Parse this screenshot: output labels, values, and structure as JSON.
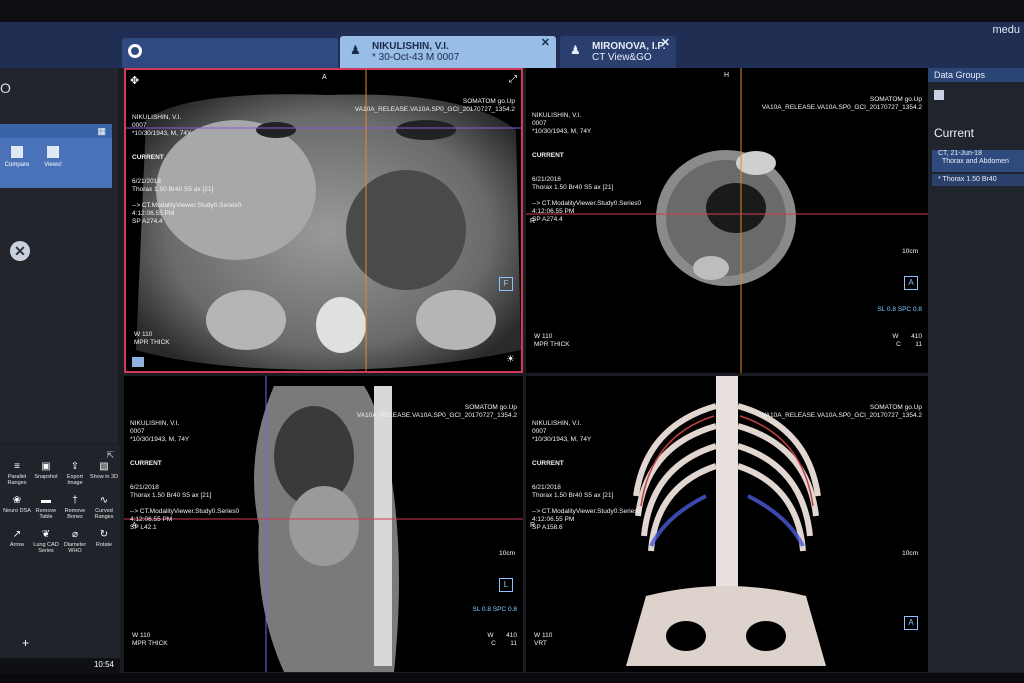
{
  "topbar": {
    "user": "medu"
  },
  "tabs": [
    {
      "name": "NIKULISHIN, V.I.",
      "sub": "* 30-Oct-43 M 0007",
      "active": true
    },
    {
      "name": "MIRONOVA, I.P.",
      "sub": "CT View&GO",
      "active": false
    }
  ],
  "left_panel": {
    "top_label": "O",
    "tools_top": [
      "Compare",
      "Views!"
    ],
    "tools": [
      {
        "label": "Parallel Ranges",
        "icon": "stack-icon"
      },
      {
        "label": "Snapshot",
        "icon": "camera-icon"
      },
      {
        "label": "Export Image",
        "icon": "export-icon"
      },
      {
        "label": "Show in 3D",
        "icon": "cube-icon"
      },
      {
        "label": "Neuro DSA",
        "icon": "brain-icon"
      },
      {
        "label": "Remove Table",
        "icon": "table-icon"
      },
      {
        "label": "Remove Bones",
        "icon": "bone-icon"
      },
      {
        "label": "Curved Ranges",
        "icon": "curve-icon"
      },
      {
        "label": "Arrow",
        "icon": "arrow-icon"
      },
      {
        "label": "Lung CAD Series",
        "icon": "lung-icon"
      },
      {
        "label": "Diameter WHO",
        "icon": "diameter-icon"
      },
      {
        "label": "Rotate",
        "icon": "rotate-icon"
      }
    ],
    "time": "10:54",
    "add": "+"
  },
  "right_panel": {
    "header": "Data Groups",
    "current": "Current",
    "group_title": "CT, 21-Jun-18",
    "group_sub": "Thorax and Abdomen",
    "series": "* Thorax 1.50 Br40"
  },
  "viewports": [
    {
      "top_left": "NIKULISHIN, V.I.\n0007\n*10/30/1943, M, 74Y",
      "top_left_bold": "CURRENT",
      "top_left_2": "6/21/2018\nThorax 1.50 Br40 S5 ax [21]\n\n--> CT.ModalityViewer.Study0.Series0\n4:12:06.55 PM\nSP A274.4",
      "top_right": "SOMATOM go.Up\nVA10A_RELEASE.VA10A.SP0_GCI_20170727_1354.2",
      "bottom_left": "W 110\nMPR THICK",
      "bottom_right": "",
      "orient_top": "A",
      "orient_left": "",
      "box": "F",
      "sl": ""
    },
    {
      "top_left": "NIKULISHIN, V.I.\n0007\n*10/30/1943, M, 74Y",
      "top_left_bold": "CURRENT",
      "top_left_2": "6/21/2018\nThorax 1.50 Br40 S5 ax [21]\n\n--> CT.ModalityViewer.Study0.Series0\n4:12:06.55 PM\nSP A274.4",
      "top_right": "SOMATOM go.Up\nVA10A_RELEASE.VA10A.SP0_GCI_20170727_1354.2",
      "bottom_left": "W 110\nMPR THICK",
      "bottom_right": "W       410\nC        11",
      "orient_top": "H",
      "orient_left": "R",
      "box": "A",
      "sl": "SL 0.8\nSPC 0.8",
      "scale": "10cm"
    },
    {
      "top_left": "NIKULISHIN, V.I.\n0007\n*10/30/1943, M, 74Y",
      "top_left_bold": "CURRENT",
      "top_left_2": "6/21/2018\nThorax 1.50 Br40 S5 ax [21]\n\n--> CT.ModalityViewer.Study0.Series0\n4:12:06.55 PM\nSP L42.1",
      "top_right": "SOMATOM go.Up\nVA10A_RELEASE.VA10A.SP0_GCI_20170727_1354.2",
      "bottom_left": "W 110\nMPR THICK",
      "bottom_right": "W       410\nC        11",
      "orient_top": "",
      "orient_left": "A",
      "box": "L",
      "sl": "SL 0.8\nSPC 0.8",
      "scale": "10cm"
    },
    {
      "top_left": "NIKULISHIN, V.I.\n0007\n*10/30/1943, M, 74Y",
      "top_left_bold": "CURRENT",
      "top_left_2": "6/21/2018\nThorax 1.50 Br40 S5 ax [21]\n\n--> CT.ModalityViewer.Study0.Series0\n4:12:06.55 PM\nSP A158.6",
      "top_right": "SOMATOM go.Up\nVA10A_RELEASE.VA10A.SP0_GCI_20170727_1354.2",
      "bottom_left": "W 110\nVRT",
      "bottom_right": "",
      "orient_top": "",
      "orient_left": "R",
      "box": "A",
      "sl": "",
      "scale": "10cm"
    }
  ]
}
